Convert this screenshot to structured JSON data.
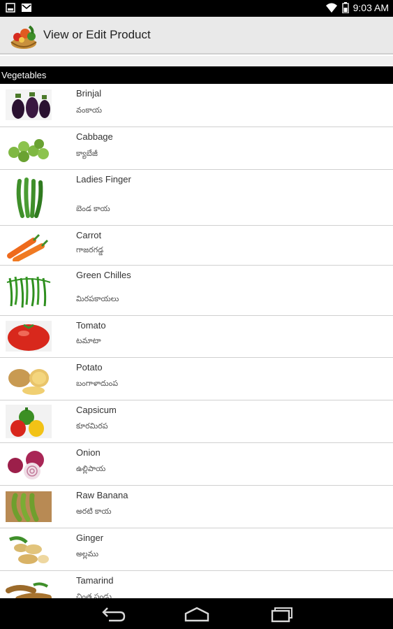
{
  "status_bar": {
    "time": "9:03 AM"
  },
  "action_bar": {
    "title": "View or Edit Product"
  },
  "section": {
    "title": "Vegetables"
  },
  "products": [
    {
      "name": "Brinjal",
      "local": "వంకాయ",
      "icon": "brinjal-image"
    },
    {
      "name": "Cabbage",
      "local": "క్యాబేజీ",
      "icon": "cabbage-image"
    },
    {
      "name": "Ladies Finger",
      "local": "బెండ కాయ",
      "icon": "ladies-finger-image"
    },
    {
      "name": "Carrot",
      "local": "గాజరగడ్డ",
      "icon": "carrot-image"
    },
    {
      "name": "Green Chilles",
      "local": "మిరపకాయలు",
      "icon": "green-chilli-image"
    },
    {
      "name": "Tomato",
      "local": "టమాటా",
      "icon": "tomato-image"
    },
    {
      "name": "Potato",
      "local": "బంగాళాదుంప",
      "icon": "potato-image"
    },
    {
      "name": "Capsicum",
      "local": "కూరమిరప",
      "icon": "capsicum-image"
    },
    {
      "name": "Onion",
      "local": "ఉల్లిపాయ",
      "icon": "onion-image"
    },
    {
      "name": "Raw Banana",
      "local": "అరటి కాయ",
      "icon": "raw-banana-image"
    },
    {
      "name": "Ginger",
      "local": "అల్లము",
      "icon": "ginger-image"
    },
    {
      "name": "Tamarind",
      "local": "చింత పండు",
      "icon": "tamarind-image"
    }
  ],
  "nav": {
    "back": "back-icon",
    "home": "home-icon",
    "recents": "recents-icon"
  }
}
